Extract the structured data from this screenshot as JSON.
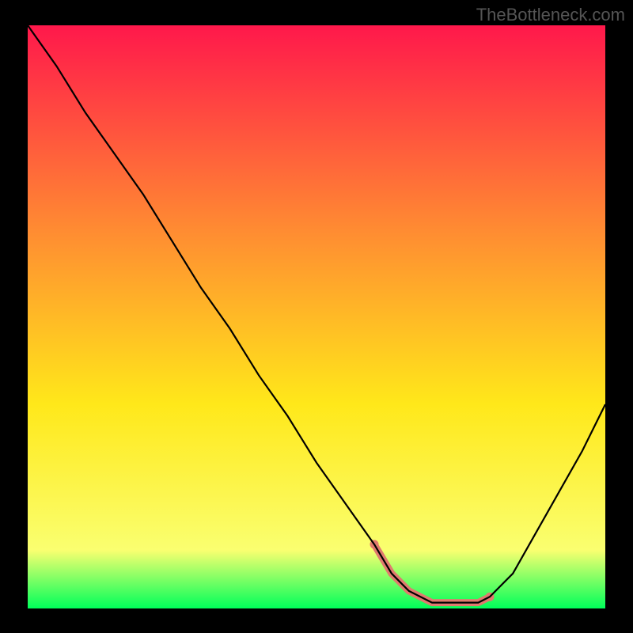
{
  "watermark": "TheBottleneck.com",
  "chart_data": {
    "type": "line",
    "title": "",
    "xlabel": "",
    "ylabel": "",
    "xlim": [
      0,
      100
    ],
    "ylim": [
      0,
      100
    ],
    "background_gradient": {
      "top": "#ff184b",
      "mid1": "#ff8b32",
      "mid2": "#ffe81a",
      "mid3": "#faff70",
      "bottom": "#00ff5a"
    },
    "curve": {
      "x": [
        0,
        5,
        10,
        15,
        20,
        25,
        30,
        35,
        40,
        45,
        50,
        55,
        60,
        63,
        66,
        70,
        74,
        78,
        80,
        84,
        88,
        92,
        96,
        100
      ],
      "y": [
        100,
        93,
        85,
        78,
        71,
        63,
        55,
        48,
        40,
        33,
        25,
        18,
        11,
        6,
        3,
        1,
        1,
        1,
        2,
        6,
        13,
        20,
        27,
        35
      ]
    },
    "highlight": {
      "color": "#e07a6e",
      "x": [
        60,
        63,
        66,
        70,
        74,
        78,
        80
      ],
      "y": [
        11,
        6,
        3,
        1,
        1,
        1,
        2
      ]
    }
  }
}
